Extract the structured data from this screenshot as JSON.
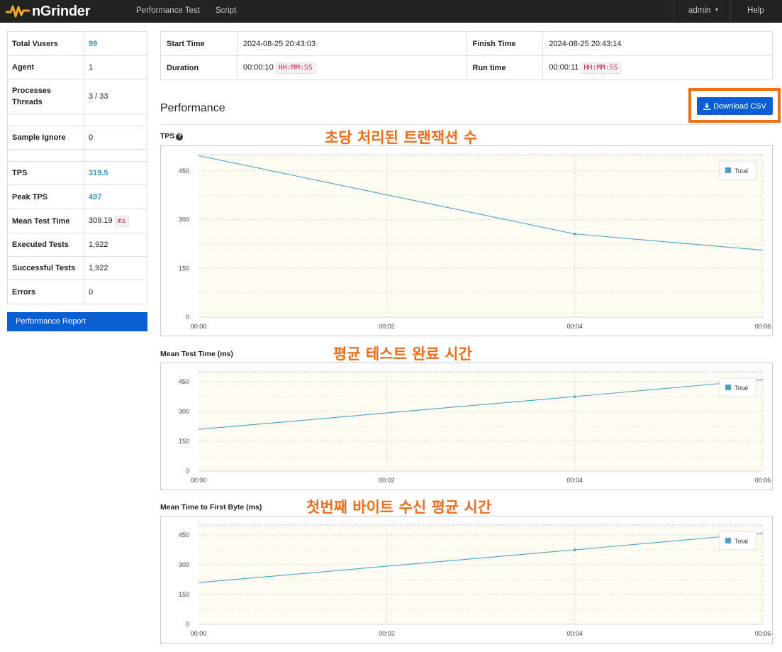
{
  "navbar": {
    "brand": "nGrinder",
    "links": [
      "Performance Test",
      "Script"
    ],
    "user": "admin",
    "help": "Help"
  },
  "summary": {
    "total_vusers_label": "Total Vusers",
    "total_vusers": "99",
    "agent_label": "Agent",
    "agent": "1",
    "processes_label": "Processes",
    "threads_label": "Threads",
    "processes_threads": "3 / 33",
    "sample_ignore_label": "Sample Ignore",
    "sample_ignore": "0",
    "tps_label": "TPS",
    "tps": "319.5",
    "peak_tps_label": "Peak TPS",
    "peak_tps": "497",
    "mean_test_time_label": "Mean Test Time",
    "mean_test_time": "309.19",
    "mean_test_time_unit": "ms",
    "executed_tests_label": "Executed Tests",
    "executed_tests": "1,922",
    "successful_tests_label": "Successful Tests",
    "successful_tests": "1,922",
    "errors_label": "Errors",
    "errors": "0",
    "report_button": "Performance Report"
  },
  "times": {
    "start_label": "Start Time",
    "start": "2024-08-25 20:43:03",
    "finish_label": "Finish Time",
    "finish": "2024-08-25 20:43:14",
    "duration_label": "Duration",
    "duration": "00:00:10",
    "runtime_label": "Run time",
    "runtime": "00:00:11",
    "format": "HH:MM:SS"
  },
  "performance": {
    "title": "Performance",
    "download_button": "Download CSV"
  },
  "annotations": {
    "tps": "초당 처리된 트랜잭션 수",
    "mean_test_time": "평균 테스트 완료 시간",
    "ttfb": "첫번째 바이트 수신 평균 시간"
  },
  "colors": {
    "brand_orange": "#f5a623",
    "annotation": "#ef6c1a",
    "button": "#0a5fd0",
    "series": "#4aa3c5",
    "plot_bg": "#fdfbf2"
  },
  "chart_data": [
    {
      "type": "line",
      "title": "TPS",
      "x": [
        "00:00",
        "00:02",
        "00:04",
        "00:06"
      ],
      "xlim": [
        0,
        6
      ],
      "ylim": [
        0,
        500
      ],
      "yticks": [
        0,
        150,
        300,
        450
      ],
      "legend": "top-right",
      "grid": true,
      "series": [
        {
          "name": "Total",
          "points": [
            [
              0,
              497
            ],
            [
              4,
              256
            ],
            [
              6,
              206
            ]
          ]
        }
      ]
    },
    {
      "type": "line",
      "title": "Mean Test Time (ms)",
      "x": [
        "00:00",
        "00:02",
        "00:04",
        "00:06"
      ],
      "xlim": [
        0,
        6
      ],
      "ylim": [
        0,
        500
      ],
      "yticks": [
        0,
        150,
        300,
        450
      ],
      "legend": "top-right",
      "grid": true,
      "series": [
        {
          "name": "Total",
          "points": [
            [
              0,
              210
            ],
            [
              4,
              375
            ],
            [
              6,
              460
            ]
          ]
        }
      ]
    },
    {
      "type": "line",
      "title": "Mean Time to First Byte (ms)",
      "x": [
        "00:00",
        "00:02",
        "00:04",
        "00:06"
      ],
      "xlim": [
        0,
        6
      ],
      "ylim": [
        0,
        500
      ],
      "yticks": [
        0,
        150,
        300,
        450
      ],
      "legend": "top-right",
      "grid": true,
      "series": [
        {
          "name": "Total",
          "points": [
            [
              0,
              210
            ],
            [
              4,
              375
            ],
            [
              6,
              460
            ]
          ]
        }
      ]
    }
  ]
}
